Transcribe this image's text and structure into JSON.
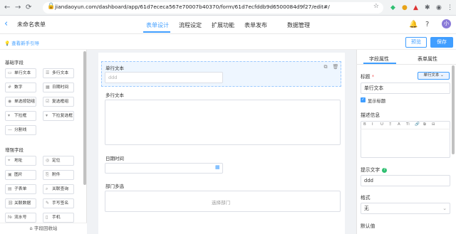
{
  "browser": {
    "url": "jiandaoyun.com/dashboard/app/61d7ececa567e70007b40370/form/61d7ecfddb9d6500084d9f27/edit#/"
  },
  "header": {
    "form_name": "未命名表单",
    "tabs": [
      {
        "label": "表单设计",
        "active": true
      },
      {
        "label": "流程设定"
      },
      {
        "label": "扩展功能"
      },
      {
        "label": "表单发布"
      },
      {
        "label": "数据管理"
      }
    ],
    "avatar_text": "小"
  },
  "toolbar": {
    "guide_label": "查看新手引导",
    "preview_label": "预览",
    "save_label": "保存"
  },
  "left_panel": {
    "basic_title": "基础字段",
    "basic_fields": [
      "单行文本",
      "多行文本",
      "数字",
      "日期时间",
      "单选按钮组",
      "复选框组",
      "下拉框",
      "下拉复选框",
      "分割线"
    ],
    "enhanced_title": "增强字段",
    "enhanced_fields": [
      "地址",
      "定位",
      "图片",
      "附件",
      "子表单",
      "关联查询",
      "关联数据",
      "手写签名",
      "流水号",
      "手机"
    ],
    "recycle_label": "字段回收站"
  },
  "canvas": {
    "fields": [
      {
        "label": "单行文本",
        "placeholder": "ddd"
      },
      {
        "label": "多行文本"
      },
      {
        "label": "日期时间"
      },
      {
        "label": "部门多选",
        "placeholder": "选择部门"
      }
    ]
  },
  "right_panel": {
    "tab_field": "字段属性",
    "tab_form": "表单属性",
    "title_label": "标题",
    "required_mark": "*",
    "type_button": "单行文本",
    "title_value": "单行文本",
    "show_title_label": "显示标题",
    "desc_label": "描述信息",
    "editor_tools": [
      "B",
      "I",
      "U",
      "Ξ",
      "A",
      "Ti",
      "🔗",
      "⧉",
      "⊟"
    ],
    "hint_label": "提示文字",
    "hint_value": "ddd",
    "format_label": "格式",
    "format_value": "无",
    "default_label": "默认值"
  },
  "colors": {
    "accent": "#409eff",
    "canvas_bg": "#f0f2f5"
  }
}
